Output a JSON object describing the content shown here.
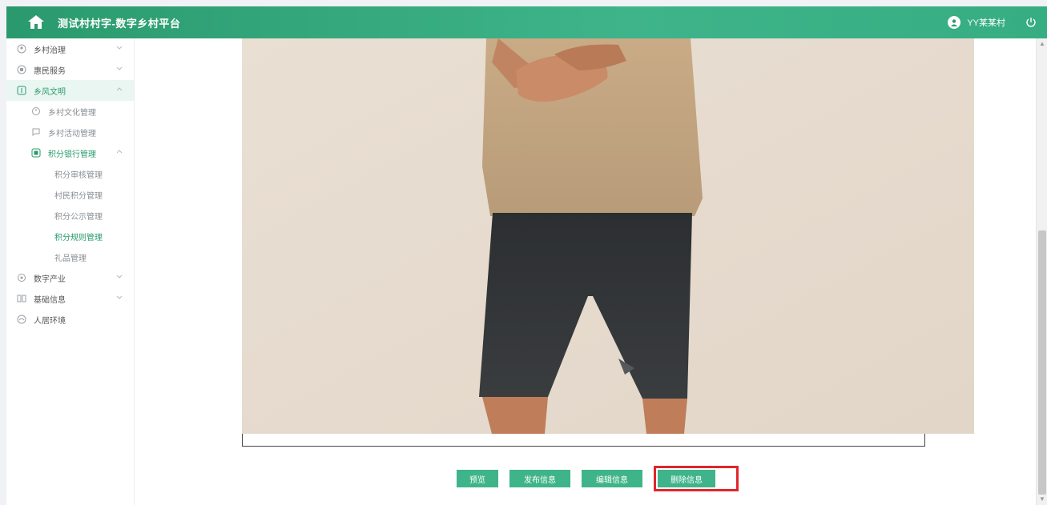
{
  "header": {
    "title": "测试村村字-数字乡村平台",
    "user_name": "YY某某村",
    "logo_icon": "house-logo-icon",
    "avatar_icon": "user-avatar-icon",
    "power_icon": "power-icon"
  },
  "sidebar": {
    "items": [
      {
        "label": "乡村治理",
        "icon": "governance-icon",
        "level": 1,
        "state": "collapsed"
      },
      {
        "label": "惠民服务",
        "icon": "service-icon",
        "level": 1,
        "state": "collapsed"
      },
      {
        "label": "乡风文明",
        "icon": "civilization-icon",
        "level": 1,
        "state": "expanded"
      },
      {
        "label": "乡村文化管理",
        "icon": "culture-icon",
        "level": 2
      },
      {
        "label": "乡村活动管理",
        "icon": "activity-icon",
        "level": 2
      },
      {
        "label": "积分银行管理",
        "icon": "bank-icon",
        "level": 2,
        "state": "expanded"
      },
      {
        "label": "积分审核管理",
        "level": 3
      },
      {
        "label": "村民积分管理",
        "level": 3
      },
      {
        "label": "积分公示管理",
        "level": 3
      },
      {
        "label": "积分规则管理",
        "level": 3,
        "current": true
      },
      {
        "label": "礼品管理",
        "level": 3
      },
      {
        "label": "数字产业",
        "icon": "industry-icon",
        "level": 1,
        "state": "collapsed"
      },
      {
        "label": "基础信息",
        "icon": "info-icon",
        "level": 1,
        "state": "collapsed"
      },
      {
        "label": "人居环境",
        "icon": "environment-icon",
        "level": 1
      }
    ]
  },
  "buttons": {
    "preview": "预览",
    "publish": "发布信息",
    "edit": "编辑信息",
    "delete": "删除信息"
  },
  "colors": {
    "primary": "#3fb48a",
    "header_dark": "#2a9a6e",
    "highlight_box": "#e0262b"
  }
}
